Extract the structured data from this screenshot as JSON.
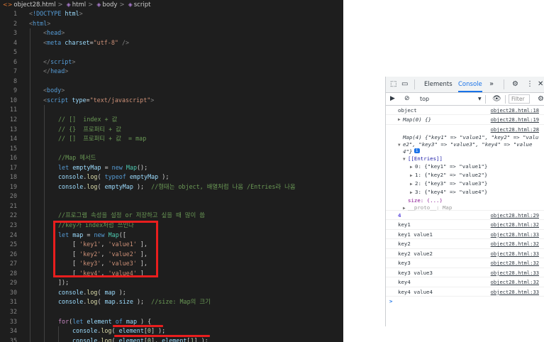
{
  "editor": {
    "breadcrumb": {
      "file": "object28.html",
      "sep": ">",
      "item2": "html",
      "item3": "body",
      "item4": "script"
    }
  },
  "devtools": {
    "tabs": {
      "elements": "Elements",
      "console": "Console",
      "more": "»"
    },
    "toolbar": {
      "context": "top",
      "filter_placeholder": "Filter"
    },
    "badge_count": "i",
    "messages": {
      "m1": {
        "text": "object",
        "src": "object28.html:18"
      },
      "m2": {
        "text": "Map(0) {}",
        "src": "object28.html:19"
      },
      "m3": {
        "src": "object28.html:28",
        "l1": "Map(4) {\"key1\" => \"value1\", \"key2\" => \"valu",
        "l2": "e2\", \"key3\" => \"value3\", \"key4\" => \"value",
        "l3": "4\"}",
        "entries": "[[Entries]]",
        "e0": "0: {\"key1\" => \"value1\"}",
        "e1": "1: {\"key2\" => \"value2\"}",
        "e2": "2: {\"key3\" => \"value3\"}",
        "e3": "3: {\"key4\" => \"value4\"}",
        "size": "size: (...)",
        "proto": "__proto__: Map"
      },
      "m4": {
        "text": "4",
        "src": "object28.html:29"
      },
      "m5": {
        "text": "key1",
        "src": "object28.html:32"
      },
      "m6": {
        "text": "key1 value1",
        "src": "object28.html:33"
      },
      "m7": {
        "text": "key2",
        "src": "object28.html:32"
      },
      "m8": {
        "text": "key2 value2",
        "src": "object28.html:33"
      },
      "m9": {
        "text": "key3",
        "src": "object28.html:32"
      },
      "m10": {
        "text": "key3 value3",
        "src": "object28.html:33"
      },
      "m11": {
        "text": "key4",
        "src": "object28.html:32"
      },
      "m12": {
        "text": "key4 value4",
        "src": "object28.html:33"
      }
    },
    "prompt": ">"
  },
  "colors": {
    "editor_bg": "#1e1e1e",
    "highlight": "#e81e1e",
    "devtools_accent": "#1a73e8"
  },
  "icons": [
    "html-file-icon",
    "symbol-icon",
    "inspect-icon",
    "device-icon",
    "gear-icon",
    "kebab-icon",
    "close-icon",
    "sidebar-icon",
    "clear-icon",
    "eye-icon",
    "dropdown-icon"
  ]
}
